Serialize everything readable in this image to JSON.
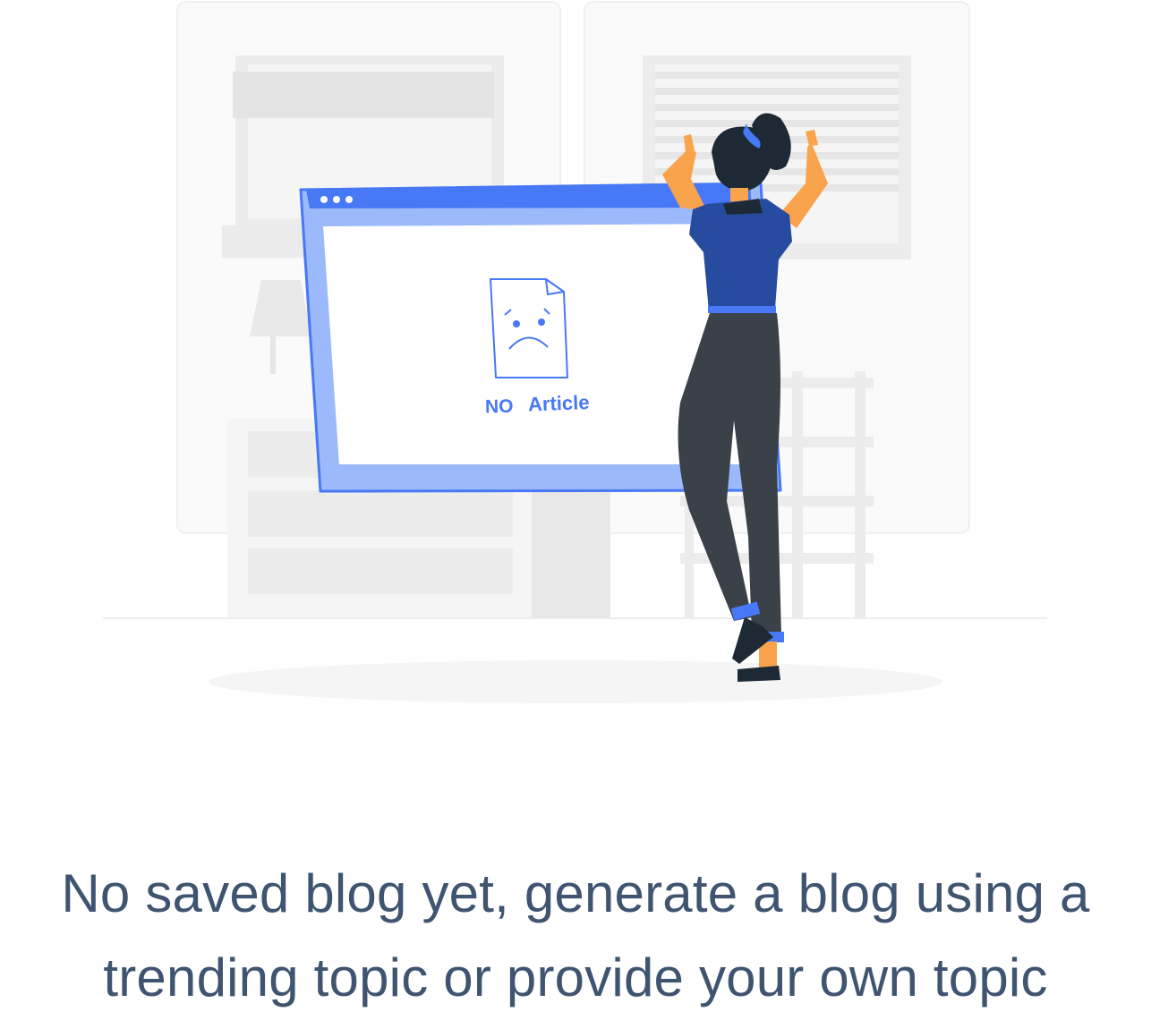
{
  "illustration": {
    "screen_label_no": "NO",
    "screen_label_article": "Article",
    "accent_color": "#4778f5",
    "frame_color": "#9cbafb",
    "icon": "sad-document-icon"
  },
  "empty_state": {
    "line1": "No saved blog yet, generate a blog using a",
    "line2": "trending topic or provide your own topic"
  },
  "colors": {
    "text": "#3f5470",
    "shirt": "#274b9f",
    "pants": "#3b4149",
    "skin": "#f9a34d"
  }
}
